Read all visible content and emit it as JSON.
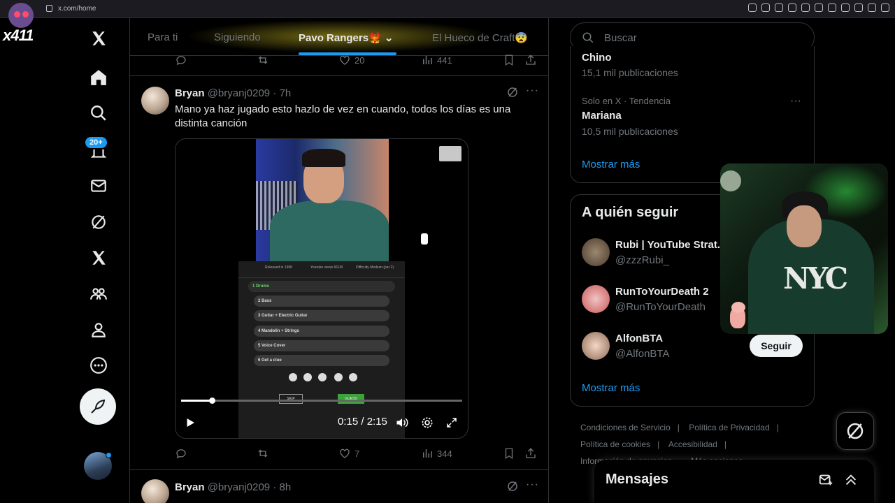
{
  "browser": {
    "url": "x.com/home"
  },
  "stream": {
    "logo_text": "x411"
  },
  "nav": {
    "notifications_badge": "20+"
  },
  "tabs": [
    {
      "label": "Para ti"
    },
    {
      "label": "Siguiendo"
    },
    {
      "label": "Pavo Rangers🐦‍🔥"
    },
    {
      "label": "El Hueco de Craft😨"
    }
  ],
  "prev_tweet_actions": {
    "likes": "20",
    "views": "441"
  },
  "tweet1": {
    "name": "Bryan",
    "handle": "@bryanj0209 · 7h",
    "text": "Mano ya haz jugado esto hazlo de vez en cuando, todos los días es una distinta canción",
    "likes": "7",
    "views": "344",
    "video": {
      "time": "0:15 / 2:15",
      "progress": 0.11,
      "game_header": [
        "Released in 1998",
        "Youtube views 661M",
        "Difficulty Medium (par 2)"
      ],
      "game_rows": [
        "1  Drums",
        "2  Bass",
        "3  Guitar + Electric Guitar",
        "4  Mandolin + Strings",
        "5  Voice Cover",
        "6  Get a clue"
      ],
      "skip": "SKIP",
      "guess": "GUESS"
    }
  },
  "tweet2": {
    "name": "Bryan",
    "handle": "@bryanj0209 · 8h"
  },
  "search": {
    "placeholder": "Buscar"
  },
  "trends": {
    "partial_name": "Chino",
    "partial_posts": "15,1 mil publicaciones",
    "item_meta": "Solo en X · Tendencia",
    "item_name": "Mariana",
    "item_posts": "10,5 mil publicaciones",
    "show_more": "Mostrar más"
  },
  "who_to_follow": {
    "title": "A quién seguir",
    "users": [
      {
        "name": "Rubi | YouTube Strat...",
        "handle": "@zzzRubi_"
      },
      {
        "name": "RunToYourDeath 2",
        "handle": "@RunToYourDeath"
      },
      {
        "name": "AlfonBTA",
        "handle": "@AlfonBTA"
      }
    ],
    "follow_label": "Seguir",
    "show_more": "Mostrar más"
  },
  "footer": {
    "links": [
      "Condiciones de Servicio",
      "|",
      "Política de Privacidad",
      "|",
      "Política de cookies",
      "|",
      "Accesibilidad",
      "|",
      "Información de anuncios",
      "·",
      "Más opciones"
    ]
  },
  "messages": {
    "title": "Mensajes"
  },
  "colors": {
    "accent": "#1d9bf0",
    "background": "#000000",
    "text": "#e7e9ea",
    "muted": "#71767b",
    "border": "#2f3336"
  }
}
